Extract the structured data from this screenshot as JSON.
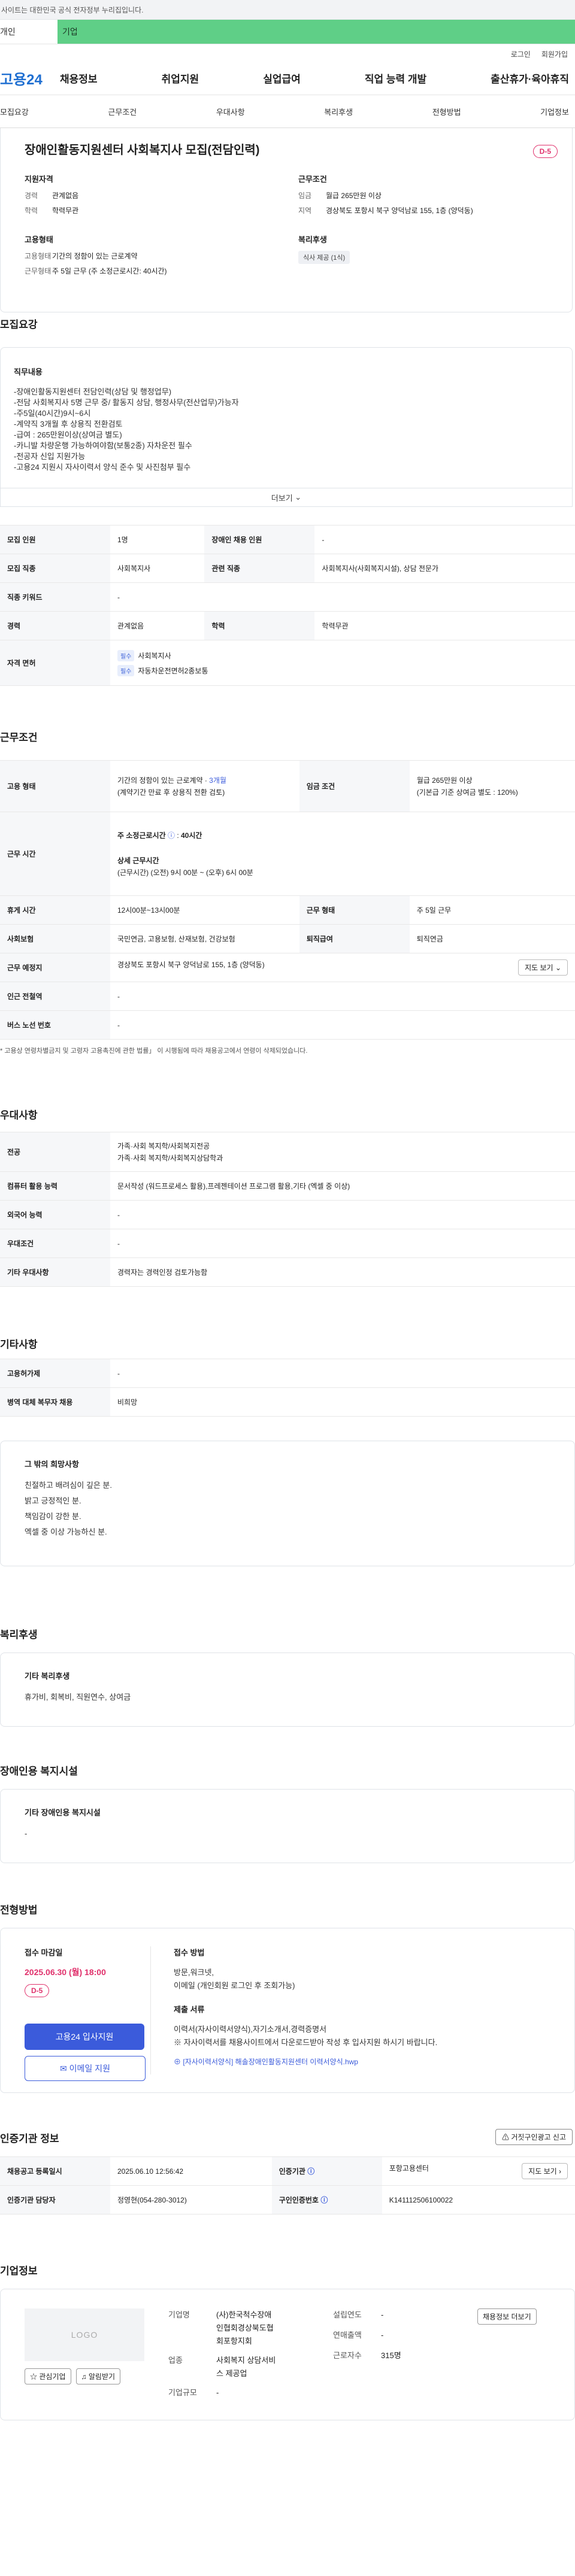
{
  "top_notice": "사이트는 대한민국 공식 전자정부 누리집입니다.",
  "tabs": {
    "individual": "개인",
    "business": "기업"
  },
  "util": {
    "login": "로그인",
    "join": "회원가입"
  },
  "logo": "고용24",
  "gnb": [
    "채용정보",
    "취업지원",
    "실업급여",
    "직업 능력 개발",
    "출산휴가·육아휴직"
  ],
  "anchors": [
    "모집요강",
    "근무조건",
    "우대사항",
    "복리후생",
    "전형방법",
    "기업정보"
  ],
  "summary": {
    "title": "장애인활동지원센터 사회복지사 모집(전담인력)",
    "dday": "D-5",
    "qual_h": "지원자격",
    "career_k": "경력",
    "career_v": "관계없음",
    "edu_k": "학력",
    "edu_v": "학력무관",
    "work_h": "근무조건",
    "pay_k": "임금",
    "pay_v": "월급 265만원 이상",
    "area_k": "지역",
    "area_v": "경상북도 포항시 북구 양덕남로 155, 1층 (양덕동)",
    "type_h": "고용형태",
    "type_k": "고용형태",
    "type_v": "기간의 정함이 있는 근로계약",
    "shift_k": "근무형태",
    "shift_v": "주 5일 근무 (주 소정근로시간: 40시간)",
    "welfare_h": "복리후생",
    "welfare_v": "식사 제공 (1식)"
  },
  "recruit": {
    "title": "모집요강",
    "desc_h": "직무내용",
    "lines": [
      "-장애인활동지원센터 전담인력(상담 및 행정업무)",
      "-전담 사회복지사 5명 근무 중/ 활동지 상담, 행정사무(전산업무)가능자",
      "-주5일(40시간)9시~6시",
      "-계약직 3개월 후 상용직 전환검토",
      "-급여 : 265만원이상(상여금 별도)",
      "-카니발 차량운행 가능하여야함(보통2종) 자차운전 필수",
      "-전공자 신입 지원가능",
      "-고용24 지원시 자사이력서 양식 준수 및 사진첨부 필수"
    ],
    "more": "더보기",
    "rows": [
      {
        "k1": "모집 인원",
        "v1": "1명",
        "k2": "장애인 채용 인원",
        "v2": "-"
      },
      {
        "k1": "모집 직종",
        "v1": "사회복지사",
        "k2": "관련 직종",
        "v2": "사회복지사(사회복지시설), 상담 전문가"
      },
      {
        "k1": "직종 키워드",
        "v1": "-"
      },
      {
        "k1": "경력",
        "v1": "관계없음",
        "k2": "학력",
        "v2": "학력무관"
      }
    ],
    "license_k": "자격 면허",
    "license_badge": "필수",
    "licenses": [
      "사회복지사",
      "자동차운전면허2종보통"
    ]
  },
  "conditions": {
    "title": "근무조건",
    "emp_k": "고용 형태",
    "emp_v1": "기간의 정함이 있는 근로계약 · ",
    "emp_v1b": "3개월",
    "emp_v2": "(계약기간 만료 후 상용직 전환 검토)",
    "wage_k": "임금 조건",
    "wage_v1": "월급 265만원 이상",
    "wage_v2": "(기본급 기준 상여금 별도 : 120%)",
    "hours_k": "근무 시간",
    "hours_h1": "주 소정근로시간",
    "hours_v1": "40시간",
    "hours_h2": "상세 근무시간",
    "hours_v2": "(근무시간) (오전) 9시 00분 ~ (오후) 6시 00분",
    "rest_k": "휴게 시간",
    "rest_v": "12시00분~13시00분",
    "form_k": "근무 형태",
    "form_v": "주 5일 근무",
    "ins_k": "사회보험",
    "ins_v": "국민연금, 고용보험, 산재보험, 건강보험",
    "ret_k": "퇴직급여",
    "ret_v": "퇴직연금",
    "place_k": "근무 예정지",
    "place_v": "경상북도 포항시 북구 양덕남로 155, 1층 (양덕동)",
    "map_btn": "지도 보기",
    "subway_k": "인근 전철역",
    "subway_v": "-",
    "bus_k": "버스 노선 번호",
    "bus_v": "-",
    "note": "* 고용상 연령차별금지 및 고령자 고용촉진에 관한 법률」 이 시행됨에 따라 채용공고에서 연령이 삭제되었습니다."
  },
  "prefer": {
    "title": "우대사항",
    "major_k": "전공",
    "major_v1": "가족·사회 복지학/사회복지전공",
    "major_v2": "가족·사회 복지학/사회복지상담학과",
    "pc_k": "컴퓨터 활용 능력",
    "pc_v": "문서작성 (워드프로세스 활용),프레젠테이션 프로그램 활용,기타 (엑셀 중 이상)",
    "lang_k": "외국어 능력",
    "lang_v": "-",
    "cond_k": "우대조건",
    "cond_v": "-",
    "etc_k": "기타 우대사항",
    "etc_v": "경력자는 경력인정 검토가능함"
  },
  "other": {
    "title": "기타사항",
    "emp_k": "고용허가제",
    "emp_v": "-",
    "mil_k": "병역 대체 복무자 채용",
    "mil_v": "비희망",
    "talent_h": "그 밖의 희망사항",
    "talent_lines": [
      "친절하고 배려심이 깊은 분.",
      "밝고 긍정적인 분.",
      "책임감이 강한 분.",
      "엑셀 중 이상 가능하신 분."
    ]
  },
  "welfare": {
    "title": "복리후생",
    "h": "기타 복리후생",
    "v": "휴가비, 회복비, 직원연수, 상여금"
  },
  "disability": {
    "title": "장애인용 복지시설",
    "h": "기타 장애인용 복지시설",
    "v": "-"
  },
  "apply": {
    "title": "전형방법",
    "deadline_h": "접수 마감일",
    "deadline_v": "2025.06.30 (월) 18:00",
    "dday": "D-5",
    "btn_apply": "고용24 입사지원",
    "btn_email": "이메일 지원",
    "method_h": "접수 방법",
    "method_lines": [
      "방문,워크넷,",
      "이메일 (개인회원 로그인 후 조회가능)"
    ],
    "docs_h": "제출 서류",
    "docs_lines": [
      "이력서(자사이력서양식),자기소개서,경력증명서",
      "※ 자사이력서를 채용사이트에서 다운로드받아 작성 후 입사지원 하시기 바랍니다."
    ],
    "file": "[자사이력서양식] 해솔장애인활동지원센터 이력서양식.hwp"
  },
  "agency": {
    "title": "인증기관 정보",
    "report_btn": "거짓구인광고 신고",
    "reg_k": "채용공고 등록일시",
    "reg_v": "2025.06.10 12:56:42",
    "org_k": "인증기관",
    "org_v": "포항고용센터",
    "map_btn": "지도 보기",
    "staff_k": "인증기관 담당자",
    "staff_v": "정영현(054-280-3012)",
    "num_k": "구인인증번호",
    "num_v": "K141112506100022"
  },
  "company": {
    "title": "기업정보",
    "logo": "LOGO",
    "fav_btn": "관심기업",
    "alarm_btn": "알림받기",
    "name_k": "기업명",
    "name_v": "(사)한국척수장애인협회경상북도협회포항지회",
    "ind_k": "업종",
    "ind_v": "사회복지 상담서비스 제공업",
    "scale_k": "기업규모",
    "scale_v": "-",
    "year_k": "설립연도",
    "year_v": "-",
    "sales_k": "연매출액",
    "sales_v": "-",
    "emp_k": "근로자수",
    "emp_v": "315명",
    "more_btn": "채용정보 더보기"
  }
}
